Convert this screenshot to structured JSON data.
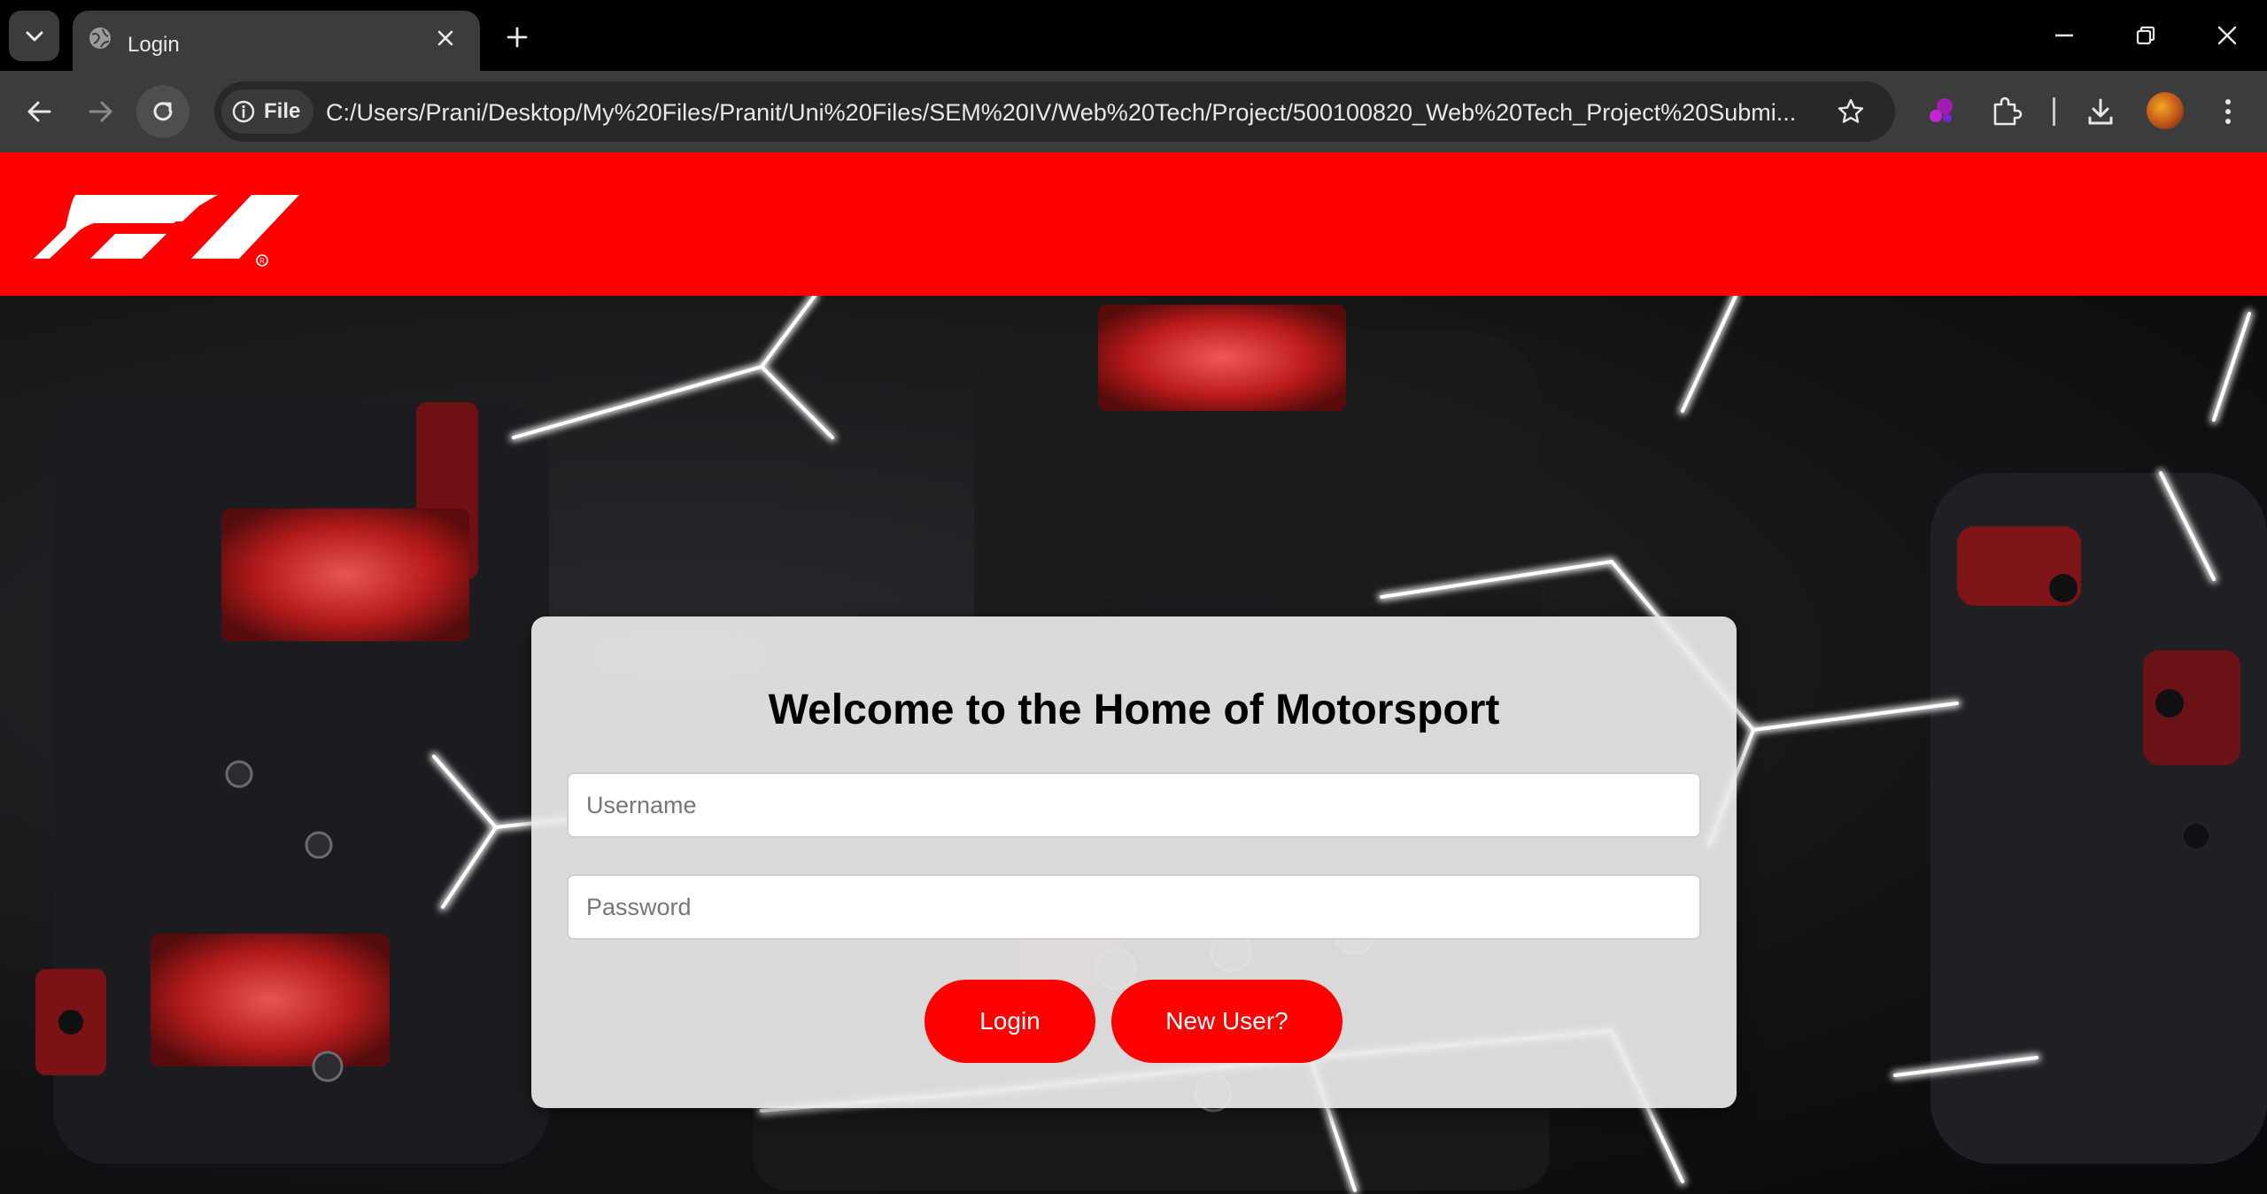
{
  "browser": {
    "tab": {
      "title": "Login"
    },
    "address_bar": {
      "chip_label": "File",
      "url": "C:/Users/Prani/Desktop/My%20Files/Pranit/Uni%20Files/SEM%20IV/Web%20Tech/Project/500100820_Web%20Tech_Project%20Submi..."
    }
  },
  "header": {
    "logo": "F1",
    "brand_color": "#ff0000"
  },
  "login": {
    "title": "Welcome to the Home of Motorsport",
    "username_placeholder": "Username",
    "password_placeholder": "Password",
    "login_label": "Login",
    "new_user_label": "New User?"
  },
  "icons": {
    "tab_search": "chevron-down-icon",
    "tab_favicon": "globe-icon",
    "tab_close": "close-icon",
    "new_tab": "plus-icon",
    "minimize": "minimize-icon",
    "restore": "restore-icon",
    "close_window": "close-icon",
    "back": "arrow-left-icon",
    "forward": "arrow-right-icon",
    "reload": "reload-icon",
    "site_info": "info-icon",
    "bookmark": "star-icon",
    "extension_ai": "sparkle-icon",
    "extensions": "puzzle-icon",
    "downloads": "download-icon",
    "menu": "kebab-menu-icon"
  }
}
